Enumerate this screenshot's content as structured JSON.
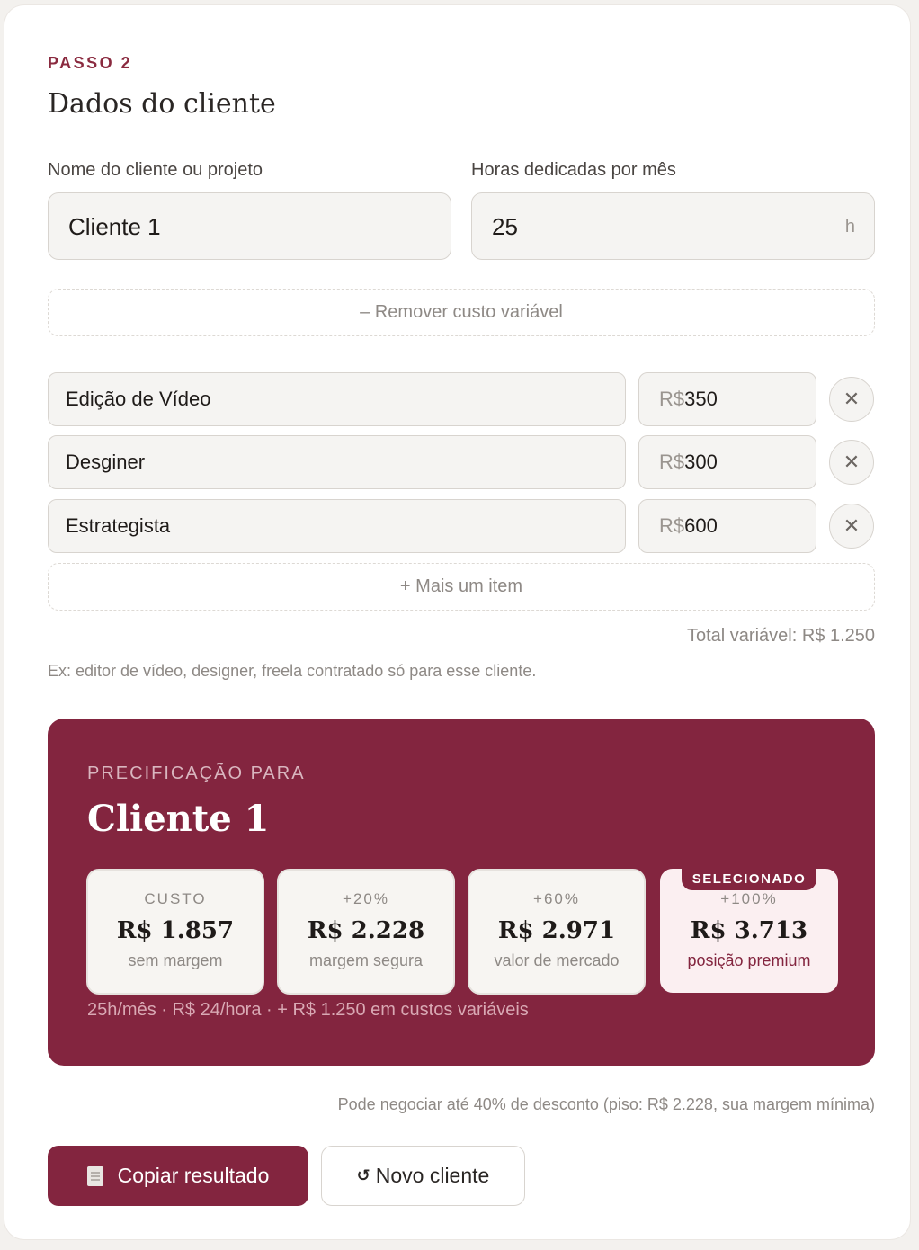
{
  "step": {
    "label": "PASSO 2",
    "title": "Dados do cliente"
  },
  "form": {
    "client_label": "Nome do cliente ou projeto",
    "client_value": "Cliente 1",
    "hours_label": "Horas dedicadas por mês",
    "hours_value": "25",
    "hours_suffix": "h",
    "remove_variable_label": "– Remover custo variável"
  },
  "items": [
    {
      "name": "Edição de Vídeo",
      "currency": "R$",
      "value": "350"
    },
    {
      "name": "Desginer",
      "currency": "R$",
      "value": "300"
    },
    {
      "name": "Estrategista",
      "currency": "R$",
      "value": "600"
    }
  ],
  "add_item_label": "+ Mais um item",
  "total_variable": "Total variável: R$ 1.250",
  "hint": "Ex: editor de vídeo, designer, freela contratado só para esse cliente.",
  "pricing": {
    "label": "PRECIFICAÇÃO PARA",
    "client": "Cliente 1",
    "tiers": [
      {
        "top": "CUSTO",
        "value": "R$ 1.857",
        "sub": "sem margem"
      },
      {
        "top": "+20%",
        "value": "R$ 2.228",
        "sub": "margem segura"
      },
      {
        "top": "+60%",
        "value": "R$ 2.971",
        "sub": "valor de mercado"
      },
      {
        "top": "+100%",
        "value": "R$ 3.713",
        "sub": "posição premium",
        "badge": "SELECIONADO"
      }
    ],
    "footer": "25h/mês · R$ 24/hora · + R$ 1.250 em custos variáveis"
  },
  "negotiation_note": "Pode negociar até 40% de desconto (piso: R$ 2.228, sua margem mínima)",
  "actions": {
    "copy_label": "Copiar resultado",
    "new_client_label": "Novo cliente",
    "new_client_icon": "↺"
  },
  "colors": {
    "accent": "#83253f",
    "selected_tier_bg": "#fbeff1"
  }
}
